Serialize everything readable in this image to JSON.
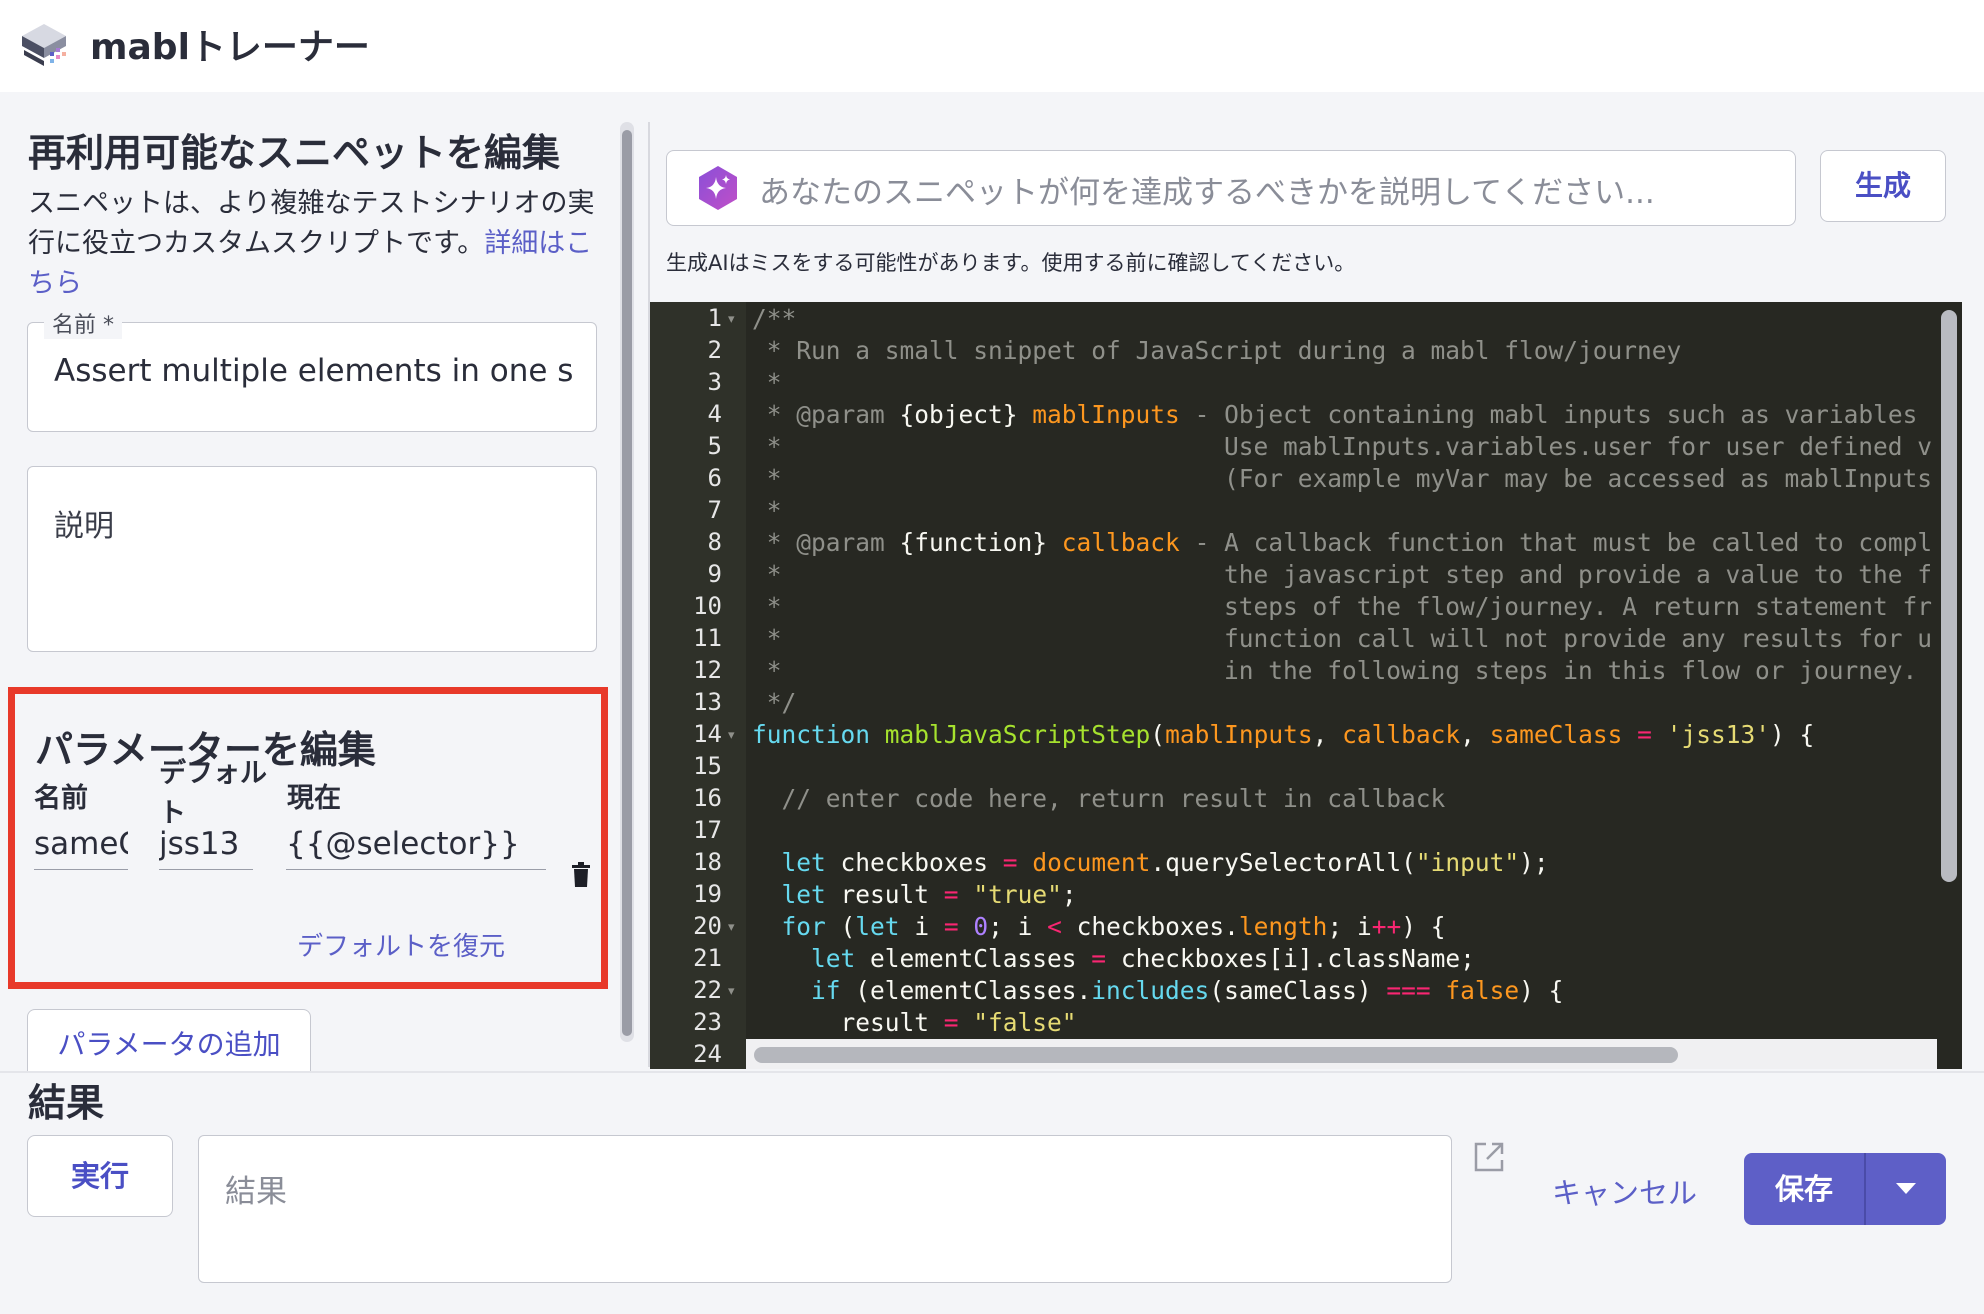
{
  "app": {
    "title": "mablトレーナー"
  },
  "snippet": {
    "heading": "再利用可能なスニペットを編集",
    "description": "スニペットは、より複雑なテストシナリオの実行に役立つカスタムスクリプトです。",
    "details_link": "詳細はこちら",
    "name_label": "名前 *",
    "name_value": "Assert multiple elements in one step",
    "desc_placeholder": "説明"
  },
  "params": {
    "heading": "パラメーターを編集",
    "col_name": "名前",
    "col_default": "デフォルト",
    "col_current": "現在",
    "rows": [
      {
        "name": "sameClass",
        "default": "jss13",
        "current": "{{@selector}}"
      }
    ],
    "restore_label": "デフォルトを復元",
    "add_label": "パラメータの追加"
  },
  "ai": {
    "placeholder": "あなたのスニペットが何を達成するべきかを説明してください...",
    "generate_label": "生成",
    "disclaimer": "生成AIはミスをする可能性があります。使用する前に確認してください。"
  },
  "editor": {
    "line_numbers": [
      "1",
      "2",
      "3",
      "4",
      "5",
      "6",
      "7",
      "8",
      "9",
      "10",
      "11",
      "12",
      "13",
      "14",
      "15",
      "16",
      "17",
      "18",
      "19",
      "20",
      "21",
      "22",
      "23",
      "24"
    ]
  },
  "result": {
    "heading": "結果",
    "run_label": "実行",
    "placeholder": "結果",
    "cancel_label": "キャンセル",
    "save_label": "保存"
  },
  "colors": {
    "accent": "#5e5fc7",
    "highlight_border": "#e8392a",
    "editor_bg": "#272822"
  }
}
